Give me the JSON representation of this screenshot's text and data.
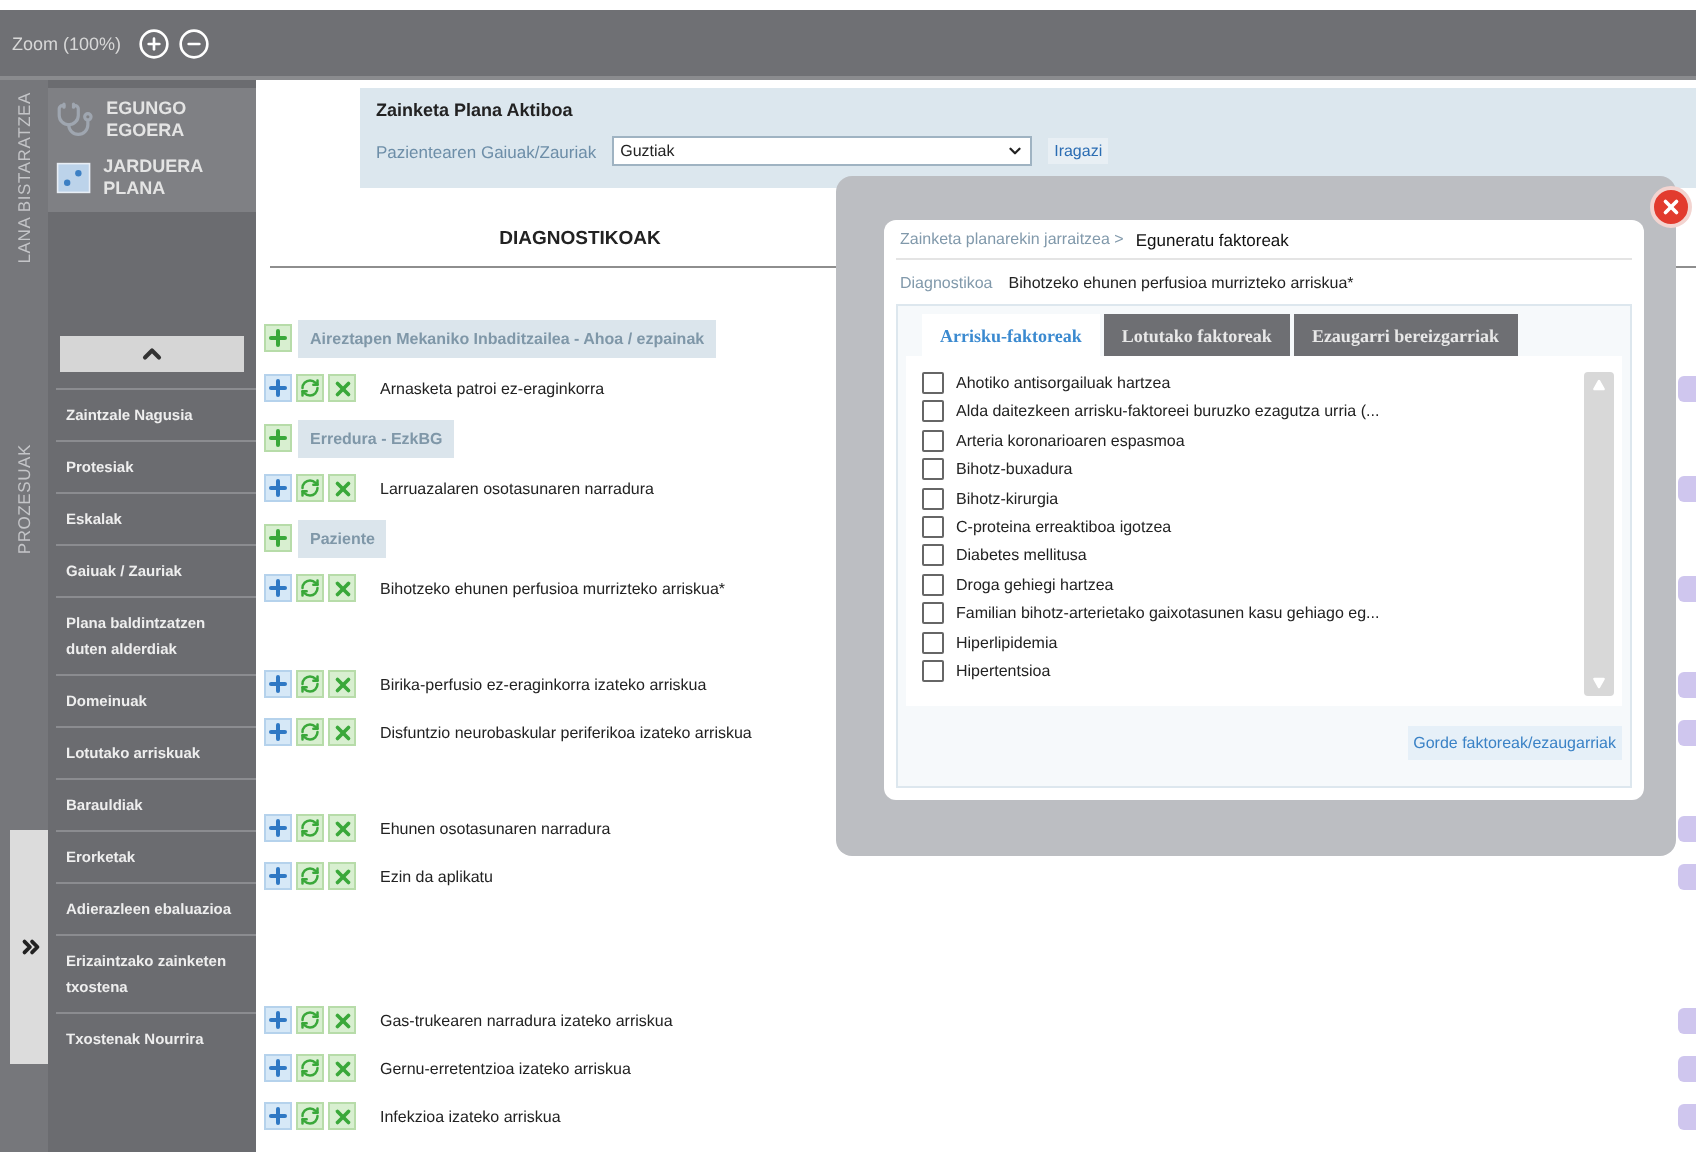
{
  "zoom": {
    "label": "Zoom (100%)"
  },
  "side_strip": {
    "top_label": "LANA BISTARATZEA",
    "bottom_label": "PROZESUAK"
  },
  "nav": [
    {
      "label": "EGUNGO EGOERA"
    },
    {
      "label": "JARDUERA PLANA"
    }
  ],
  "menu": [
    "Zaintzale Nagusia",
    "Protesiak",
    "Eskalak",
    "Gaiuak / Zauriak",
    "Plana baldintzatzen duten alderdiak",
    "Domeinuak",
    "Lotutako arriskuak",
    "Barauldiak",
    "Erorketak",
    "Adierazleen ebaluazioa",
    "Erizaintzako zainketen txostena",
    "Txostenak Nourrira"
  ],
  "plan": {
    "title": "Zainketa Plana Aktiboa",
    "filter_label": "Pazientearen Gaiuak/Zauriak",
    "filter_value": "Guztiak",
    "filter_button": "Iragazi"
  },
  "diagnoses": {
    "heading": "DIAGNOSTIKOAK",
    "rows": [
      {
        "kind": "group",
        "label": "Aireztapen Mekaniko Inbaditzailea - Ahoa / ezpainak"
      },
      {
        "kind": "item",
        "label": "Arnasketa patroi ez-eraginkorra"
      },
      {
        "kind": "group",
        "label": "Erredura - EzkBG"
      },
      {
        "kind": "item",
        "label": "Larruazalaren osotasunaren narradura"
      },
      {
        "kind": "group",
        "label": "Paziente"
      },
      {
        "kind": "item",
        "label": "Bihotzeko ehunen perfusioa murrizteko arriskua*"
      },
      {
        "kind": "spacer"
      },
      {
        "kind": "item",
        "label": "Birika-perfusio ez-eraginkorra izateko arriskua"
      },
      {
        "kind": "item",
        "label": "Disfuntzio neurobaskular periferikoa izateko arriskua"
      },
      {
        "kind": "spacer"
      },
      {
        "kind": "item",
        "label": "Ehunen osotasunaren narradura"
      },
      {
        "kind": "item",
        "label": "Ezin da aplikatu"
      },
      {
        "kind": "spacer"
      },
      {
        "kind": "spacer"
      },
      {
        "kind": "item",
        "label": "Gas-trukearen narradura izateko arriskua"
      },
      {
        "kind": "item",
        "label": "Gernu-erretentzioa izateko arriskua"
      },
      {
        "kind": "item",
        "label": "Infekzioa izateko arriskua"
      }
    ]
  },
  "modal": {
    "breadcrumb": "Zainketa planarekin jarraitzea >",
    "title": "Eguneratu faktoreak",
    "diagnosis_label": "Diagnostikoa",
    "diagnosis": "Bihotzeko ehunen perfusioa murrizteko arriskua*",
    "tabs": [
      {
        "label": "Arrisku-faktoreak",
        "selected": true
      },
      {
        "label": "Lotutako faktoreak",
        "selected": false
      },
      {
        "label": "Ezaugarri bereizgarriak",
        "selected": false
      }
    ],
    "factors": [
      {
        "label": "Ahotiko antisorgailuak hartzea",
        "checked": false
      },
      {
        "label": "Alda daitezkeen arrisku-faktoreei buruzko ezagutza urria (...",
        "checked": false
      },
      {
        "label": "Arteria koronarioaren espasmoa",
        "checked": false
      },
      {
        "label": "Bihotz-buxadura",
        "checked": false
      },
      {
        "label": "Bihotz-kirurgia",
        "checked": false
      },
      {
        "label": "C-proteina erreaktiboa igotzea",
        "checked": false
      },
      {
        "label": "Diabetes mellitusa",
        "checked": false
      },
      {
        "label": "Droga gehiegi hartzea",
        "checked": false
      },
      {
        "label": "Familian bihotz-arterietako gaixotasunen kasu gehiago eg...",
        "checked": false
      },
      {
        "label": "Hiperlipidemia",
        "checked": false
      },
      {
        "label": "Hipertentsioa",
        "checked": false
      }
    ],
    "save": "Gorde faktoreak/ezaugarriak"
  }
}
